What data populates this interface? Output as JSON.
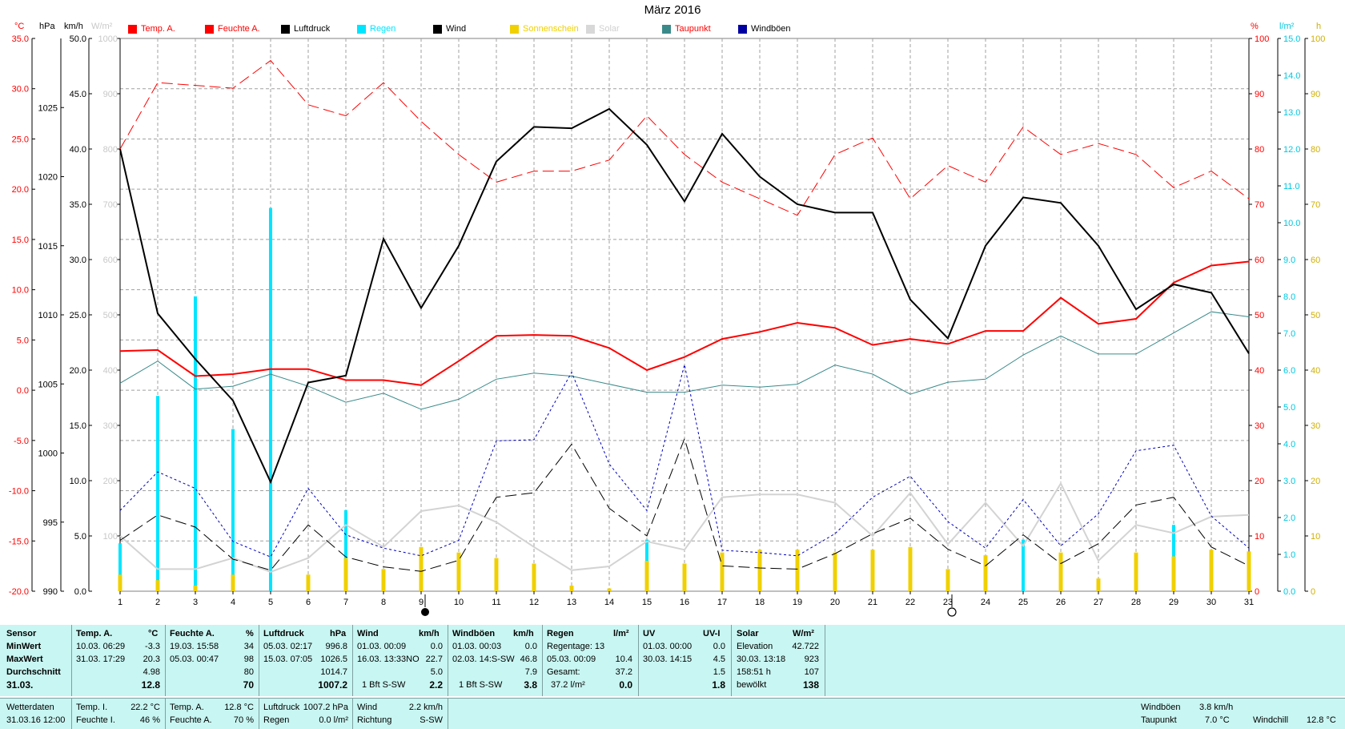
{
  "title": "März 2016",
  "legend": [
    {
      "label": "Temp. A.",
      "color": "#ff0000",
      "text_color": "#ff0000"
    },
    {
      "label": "Feuchte A.",
      "color": "#ff0000",
      "text_color": "#ff0000"
    },
    {
      "label": "Luftdruck",
      "color": "#000000",
      "text_color": "#000000"
    },
    {
      "label": "Regen",
      "color": "#00e5ff",
      "text_color": "#00e5ff"
    },
    {
      "label": "Wind",
      "color": "#000000",
      "text_color": "#000000"
    },
    {
      "label": "Sonnenschein",
      "color": "#f0d000",
      "text_color": "#f0d000"
    },
    {
      "label": "Solar",
      "color": "#d0d0d0",
      "text_color": "#d0d0d0"
    },
    {
      "label": "Taupunkt",
      "color": "#3b8a8a",
      "text_color": "#ff0000"
    },
    {
      "label": "Windböen",
      "color": "#0000a0",
      "text_color": "#000000"
    }
  ],
  "units": {
    "temp": "°C",
    "pressure": "hPa",
    "wind": "km/h",
    "solar": "W/m²",
    "humidity": "%",
    "rain": "l/m²",
    "sun": "h"
  },
  "chart_data": {
    "type": "line",
    "x": [
      1,
      2,
      3,
      4,
      5,
      6,
      7,
      8,
      9,
      10,
      11,
      12,
      13,
      14,
      15,
      16,
      17,
      18,
      19,
      20,
      21,
      22,
      23,
      24,
      25,
      26,
      27,
      28,
      29,
      30,
      31
    ],
    "axes": {
      "temp": {
        "label": "°C",
        "min": -20,
        "max": 35,
        "ticks": [
          "-20.0",
          "-15.0",
          "-10.0",
          "-5.0",
          "0.0",
          "5.0",
          "10.0",
          "15.0",
          "20.0",
          "25.0",
          "30.0",
          "35.0"
        ]
      },
      "pressure": {
        "label": "hPa",
        "min": 990,
        "max": 1030,
        "ticks": [
          "990",
          "995",
          "1000",
          "1005",
          "1010",
          "1015",
          "1020",
          "1025"
        ]
      },
      "wind": {
        "label": "km/h",
        "min": 0,
        "max": 50,
        "ticks": [
          "0.0",
          "5.0",
          "10.0",
          "15.0",
          "20.0",
          "25.0",
          "30.0",
          "35.0",
          "40.0",
          "45.0",
          "50.0"
        ]
      },
      "solar": {
        "label": "W/m²",
        "min": 0,
        "max": 1000,
        "ticks": [
          "100",
          "200",
          "300",
          "400",
          "500",
          "600",
          "700",
          "800",
          "900",
          "1000"
        ]
      },
      "humidity": {
        "label": "%",
        "min": 0,
        "max": 100,
        "ticks": [
          "0",
          "10",
          "20",
          "30",
          "40",
          "50",
          "60",
          "70",
          "80",
          "90",
          "100"
        ]
      },
      "rain": {
        "label": "l/m²",
        "min": 0,
        "max": 15,
        "ticks": [
          "0.0",
          "1.0",
          "2.0",
          "3.0",
          "4.0",
          "5.0",
          "6.0",
          "7.0",
          "8.0",
          "9.0",
          "10.0",
          "11.0",
          "12.0",
          "13.0",
          "14.0",
          "15.0"
        ]
      },
      "sun": {
        "label": "h",
        "min": 0,
        "max": 100,
        "ticks": [
          "0",
          "10",
          "20",
          "30",
          "40",
          "50",
          "60",
          "70",
          "80",
          "90",
          "100"
        ]
      }
    },
    "grid": true,
    "series": [
      {
        "name": "Temp. A.",
        "axis": "temp",
        "color": "#ff0000",
        "style": "solid",
        "width": 2,
        "x": [
          1,
          2,
          3,
          4,
          5,
          6,
          7,
          8,
          9,
          10,
          11,
          12,
          13,
          14,
          15,
          16,
          17,
          18,
          19,
          20,
          21,
          22,
          23,
          24,
          25,
          26,
          27,
          28,
          29,
          30,
          31
        ],
        "values": [
          3.9,
          4.0,
          1.4,
          1.6,
          2.1,
          2.1,
          1.0,
          1.0,
          0.5,
          2.9,
          5.4,
          5.5,
          5.4,
          4.2,
          2.0,
          3.3,
          5.1,
          5.8,
          6.7,
          6.2,
          4.5,
          5.1,
          4.6,
          5.9,
          5.9,
          9.2,
          6.6,
          7.1,
          10.7,
          12.4,
          12.8
        ]
      },
      {
        "name": "Feuchte A.",
        "axis": "humidity",
        "color": "#ff0000",
        "style": "dash",
        "width": 1,
        "x": [
          1,
          2,
          3,
          4,
          5,
          6,
          7,
          8,
          9,
          10,
          11,
          12,
          13,
          14,
          15,
          16,
          17,
          18,
          19,
          20,
          21,
          22,
          23,
          24,
          25,
          26,
          27,
          28,
          29,
          30,
          31
        ],
        "values": [
          80,
          92,
          91.5,
          91,
          96,
          88,
          86,
          92,
          85,
          79,
          74,
          76,
          76,
          78,
          86,
          79,
          74,
          71,
          68,
          79,
          82,
          71,
          77,
          74,
          84,
          79,
          81,
          79,
          73,
          76,
          71
        ]
      },
      {
        "name": "Luftdruck",
        "axis": "pressure",
        "color": "#000000",
        "style": "solid",
        "width": 2,
        "x": [
          1,
          2,
          3,
          4,
          5,
          6,
          7,
          8,
          9,
          10,
          11,
          12,
          13,
          14,
          15,
          16,
          17,
          18,
          19,
          20,
          21,
          22,
          23,
          24,
          25,
          26,
          27,
          28,
          29,
          30,
          31
        ],
        "values": [
          1022.0,
          1010.1,
          1006.8,
          1003.8,
          997.9,
          1005.1,
          1005.6,
          1015.5,
          1010.5,
          1015.0,
          1021.1,
          1023.6,
          1023.5,
          1024.9,
          1022.3,
          1018.2,
          1023.1,
          1020.0,
          1018.0,
          1017.4,
          1017.4,
          1011.1,
          1008.3,
          1015.0,
          1018.5,
          1018.1,
          1015.0,
          1010.4,
          1012.2,
          1011.6,
          1007.2
        ]
      },
      {
        "name": "Taupunkt",
        "axis": "temp",
        "color": "#3b8a8a",
        "style": "solid",
        "width": 1,
        "x": [
          1,
          2,
          3,
          4,
          5,
          6,
          7,
          8,
          9,
          10,
          11,
          12,
          13,
          14,
          15,
          16,
          17,
          18,
          19,
          20,
          21,
          22,
          23,
          24,
          25,
          26,
          27,
          28,
          29,
          30,
          31
        ],
        "values": [
          0.7,
          2.9,
          0.1,
          0.4,
          1.6,
          0.4,
          -1.2,
          -0.3,
          -1.9,
          -0.9,
          1.1,
          1.7,
          1.4,
          0.6,
          -0.2,
          -0.2,
          0.5,
          0.3,
          0.6,
          2.5,
          1.6,
          -0.4,
          0.8,
          1.1,
          3.5,
          5.4,
          3.6,
          3.6,
          5.7,
          7.8,
          7.3
        ]
      },
      {
        "name": "Wind",
        "axis": "wind",
        "color": "#000000",
        "style": "dash",
        "width": 1,
        "x": [
          1,
          2,
          3,
          4,
          5,
          6,
          7,
          8,
          9,
          10,
          11,
          12,
          13,
          14,
          15,
          16,
          17,
          18,
          19,
          20,
          21,
          22,
          23,
          24,
          25,
          26,
          27,
          28,
          29,
          30,
          31
        ],
        "values": [
          4.6,
          6.9,
          5.8,
          2.9,
          1.9,
          6.0,
          3.1,
          2.2,
          1.8,
          2.8,
          8.5,
          8.9,
          13.3,
          7.5,
          5.0,
          13.8,
          2.3,
          2.1,
          2.0,
          3.4,
          5.2,
          6.6,
          3.8,
          2.3,
          5.1,
          2.5,
          4.3,
          7.8,
          8.5,
          4.0,
          2.3
        ]
      },
      {
        "name": "Windböen",
        "axis": "wind",
        "color": "#0000c0",
        "style": "dot",
        "width": 1,
        "x": [
          1,
          2,
          3,
          4,
          5,
          6,
          7,
          8,
          9,
          10,
          11,
          12,
          13,
          14,
          15,
          16,
          17,
          18,
          19,
          20,
          21,
          22,
          23,
          24,
          25,
          26,
          27,
          28,
          29,
          30,
          31
        ],
        "values": [
          7.3,
          10.8,
          9.3,
          4.5,
          3.1,
          9.3,
          5.1,
          3.9,
          3.2,
          4.6,
          13.6,
          13.7,
          19.8,
          11.5,
          7.3,
          20.5,
          3.7,
          3.5,
          3.2,
          5.2,
          8.5,
          10.4,
          6.3,
          3.9,
          8.3,
          4.1,
          7.0,
          12.7,
          13.2,
          6.8,
          3.9
        ]
      },
      {
        "name": "Solar",
        "axis": "solar",
        "color": "#d3d3d3",
        "style": "solid",
        "width": 2,
        "x": [
          1,
          2,
          3,
          4,
          5,
          6,
          7,
          8,
          9,
          10,
          11,
          12,
          13,
          14,
          15,
          16,
          17,
          18,
          19,
          20,
          21,
          22,
          23,
          24,
          25,
          26,
          27,
          28,
          29,
          30,
          31
        ],
        "values": [
          100,
          40,
          40,
          60,
          35,
          60,
          120,
          80,
          145,
          155,
          125,
          80,
          38,
          45,
          90,
          75,
          170,
          175,
          175,
          160,
          100,
          178,
          85,
          160,
          82,
          195,
          55,
          120,
          105,
          135,
          138
        ]
      }
    ],
    "bars": [
      {
        "name": "Regen",
        "axis": "rain",
        "color": "#00e5ff",
        "x": [
          1,
          2,
          3,
          4,
          5,
          6,
          7,
          8,
          15,
          16,
          25,
          26,
          29
        ],
        "values": [
          1.3,
          5.3,
          8.0,
          4.4,
          10.4,
          0.4,
          2.2,
          0.6,
          1.4,
          0.2,
          1.4,
          0.4,
          1.8
        ]
      },
      {
        "name": "Sonnenschein",
        "axis": "sun",
        "color": "#f0d000",
        "x": [
          1,
          2,
          3,
          4,
          5,
          6,
          7,
          8,
          9,
          10,
          11,
          12,
          13,
          14,
          15,
          16,
          17,
          18,
          19,
          20,
          21,
          22,
          23,
          24,
          25,
          26,
          27,
          28,
          29,
          30,
          31
        ],
        "values": [
          3,
          2,
          1,
          3,
          0,
          3,
          6,
          4,
          8,
          7,
          6,
          5,
          1,
          0.5,
          5.5,
          5,
          7,
          7.5,
          7.5,
          7,
          7.5,
          8,
          4,
          6.5,
          0,
          7,
          2.3,
          7,
          6.3,
          7.5,
          7.2
        ]
      }
    ],
    "moon_markers": [
      {
        "x": 9,
        "phase": "new"
      },
      {
        "x": 23,
        "phase": "full"
      }
    ]
  },
  "stats": {
    "headers": {
      "sensor": "Sensor",
      "temp": "Temp. A.",
      "temp_u": "°C",
      "hum": "Feuchte A.",
      "hum_u": "%",
      "press": "Luftdruck",
      "press_u": "hPa",
      "wind": "Wind",
      "wind_u": "km/h",
      "gust": "Windböen",
      "gust_u": "km/h",
      "rain": "Regen",
      "rain_u": "l/m²",
      "uv": "UV",
      "uv_u": "UV-I",
      "solar": "Solar",
      "solar_u": "W/m²"
    },
    "row_labels": [
      "MinWert",
      "MaxWert",
      "Durchschnitt",
      "31.03."
    ],
    "temp": [
      [
        "10.03.  06:29",
        "-3.3"
      ],
      [
        "31.03.  17:29",
        "20.3"
      ],
      [
        "",
        "4.98"
      ],
      [
        "",
        "12.8"
      ]
    ],
    "hum": [
      [
        "19.03.  15:58",
        "34"
      ],
      [
        "05.03.  00:47",
        "98"
      ],
      [
        "",
        "80"
      ],
      [
        "",
        "70"
      ]
    ],
    "press": [
      [
        "05.03.  02:17",
        "996.8"
      ],
      [
        "15.03.  07:05",
        "1026.5"
      ],
      [
        "",
        "1014.7"
      ],
      [
        "",
        "1007.2"
      ]
    ],
    "wind": [
      [
        "01.03.  00:09",
        "0.0"
      ],
      [
        "16.03.  13:33NO",
        "22.7"
      ],
      [
        "",
        "5.0"
      ],
      [
        "1 Bft S-SW",
        "2.2"
      ]
    ],
    "gust": [
      [
        "01.03.  00:03",
        "0.0"
      ],
      [
        "02.03.  14:S-SW",
        "46.8"
      ],
      [
        "",
        "7.9"
      ],
      [
        "1 Bft S-SW",
        "3.8"
      ]
    ],
    "rain": [
      [
        "Regentage: 13",
        ""
      ],
      [
        "05.03.  00:09",
        "10.4"
      ],
      [
        "Gesamt:",
        "37.2"
      ],
      [
        "37.2 l/m²",
        "0.0"
      ]
    ],
    "uv": [
      [
        "01.03.  00:00",
        "0.0"
      ],
      [
        "30.03.  14:15",
        "4.5"
      ],
      [
        "",
        "1.5"
      ],
      [
        "",
        "1.8"
      ]
    ],
    "solar": [
      [
        "Elevation",
        "42.722"
      ],
      [
        "30.03.  13:18",
        "923"
      ],
      [
        "158:51 h",
        "107"
      ],
      [
        "bewölkt",
        "138"
      ]
    ]
  },
  "current": {
    "label1": "Wetterdaten",
    "label2": "31.03.16 12:00",
    "temp_i_label": "Temp. I.",
    "temp_i": "22.2 °C",
    "hum_i_label": "Feuchte I.",
    "hum_i": "46 %",
    "temp_a_label": "Temp. A.",
    "temp_a": "12.8 °C",
    "hum_a_label": "Feuchte A.",
    "hum_a": "70 %",
    "press_label": "Luftdruck",
    "press": "1007.2 hPa",
    "rain_label": "Regen",
    "rain": "0.0 l/m²",
    "wind_label": "Wind",
    "wind": "2.2 km/h",
    "dir_label": "Richtung",
    "dir": "S-SW",
    "gust_label": "Windböen",
    "gust": "3.8 km/h",
    "dew_label": "Taupunkt",
    "dew": "7.0 °C",
    "chill_label": "Windchill",
    "chill": "12.8 °C"
  }
}
